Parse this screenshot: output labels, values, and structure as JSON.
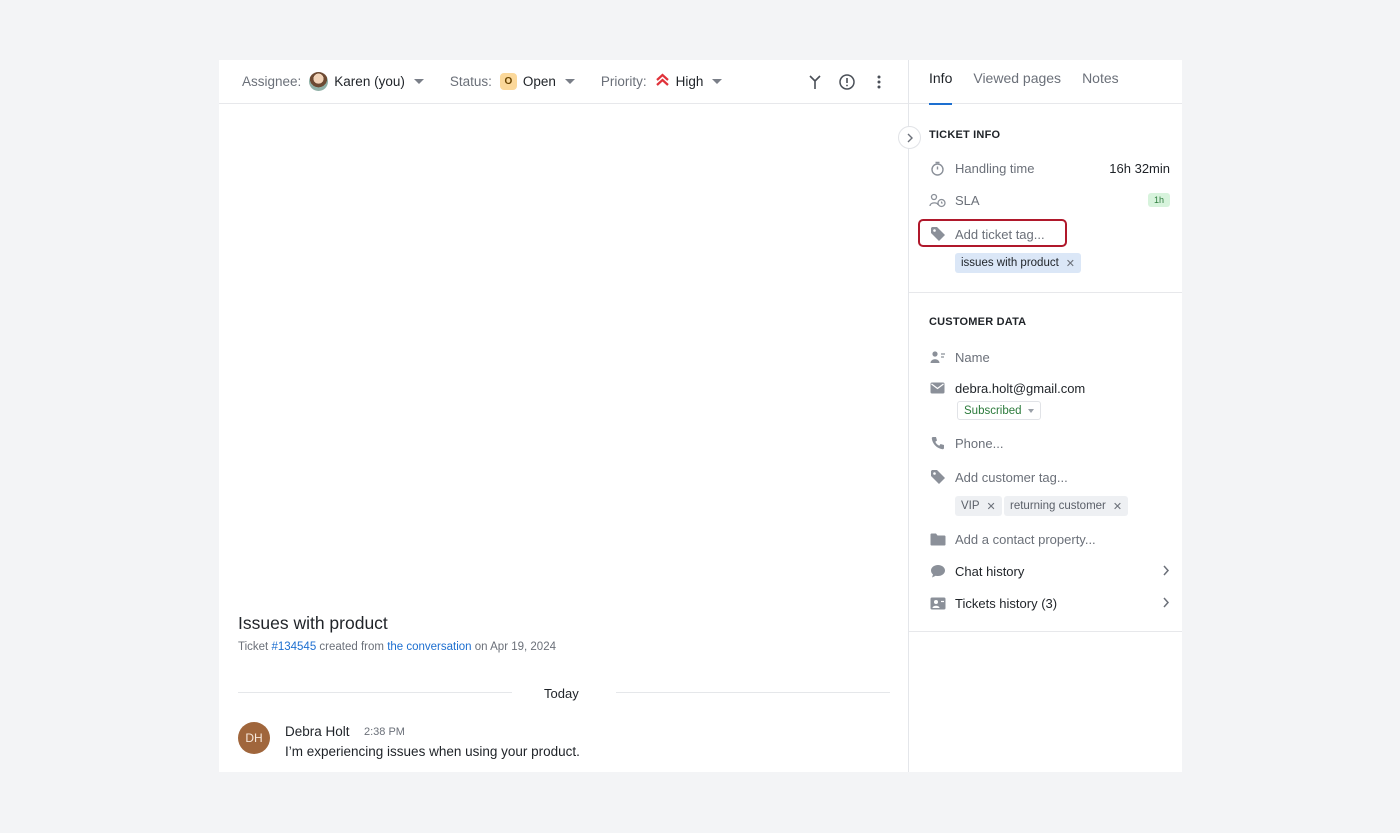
{
  "topbar": {
    "assignee_label": "Assignee:",
    "assignee_value": "Karen (you)",
    "status_label": "Status:",
    "status_badge": "O",
    "status_value": "Open",
    "priority_label": "Priority:",
    "priority_value": "High"
  },
  "ticket": {
    "title": "Issues with product",
    "sub_prefix": "Ticket ",
    "number": "#134545",
    "sub_mid": " created from ",
    "source_link": "the conversation",
    "sub_suffix": " on Apr 19, 2024"
  },
  "conversation": {
    "divider": "Today",
    "message": {
      "initials": "DH",
      "author": "Debra Holt",
      "time": "2:38 PM",
      "text": "I’m experiencing issues when using your product."
    }
  },
  "sidebar": {
    "tabs": [
      "Info",
      "Viewed pages",
      "Notes"
    ],
    "ticket_info": {
      "title": "TICKET INFO",
      "handling_label": "Handling time",
      "handling_value": "16h 32min",
      "sla_label": "SLA",
      "sla_badge": "1h",
      "tag_placeholder": "Add ticket tag...",
      "tags": [
        "issues with product"
      ]
    },
    "customer_data": {
      "title": "CUSTOMER DATA",
      "name_placeholder": "Name",
      "email": "debra.holt@gmail.com",
      "subscription": "Subscribed",
      "phone_placeholder": "Phone...",
      "customer_tag_placeholder": "Add customer tag...",
      "customer_tags": [
        "VIP",
        "returning customer"
      ],
      "contact_property": "Add a contact property...",
      "chat_history": "Chat history",
      "tickets_history": "Tickets history (3)"
    }
  },
  "colors": {
    "accent": "#1d6fd0",
    "priority_high": "#e0323a",
    "highlight": "#b0182b"
  }
}
